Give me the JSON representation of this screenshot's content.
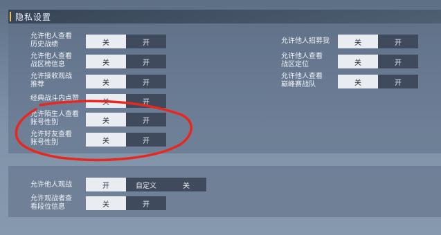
{
  "header": {
    "title": "隐私设置"
  },
  "top_left": [
    {
      "label": "允许他人查看历史战绩",
      "line1": "允许他人查看",
      "line2": "历史战绩",
      "options": [
        "关",
        "开"
      ],
      "selected": "关"
    },
    {
      "label": "允许他人查看战区榜信息",
      "line1": "允许他人查看",
      "line2": "战区榜信息",
      "options": [
        "关",
        "开"
      ],
      "selected": "关"
    },
    {
      "label": "允许接收观战推荐",
      "line1": "允许接收观战",
      "line2": "推荐",
      "options": [
        "关",
        "开"
      ],
      "selected": "关"
    },
    {
      "label": "经典战斗内点赞",
      "line1": "经典战斗内点赞",
      "line2": "",
      "options": [
        "关",
        "开"
      ],
      "selected": "关"
    },
    {
      "label": "允许陌生人查看账号性别",
      "line1": "允许陌生人查看",
      "line2": "账号性别",
      "options": [
        "关",
        "开"
      ],
      "selected": "关"
    },
    {
      "label": "允许好友查看账号性别",
      "line1": "允许好友查看",
      "line2": "账号性别",
      "options": [
        "关",
        "开"
      ],
      "selected": "关"
    }
  ],
  "top_right": [
    {
      "label": "允许他人招募我",
      "line1": "允许他人招募我",
      "line2": "",
      "options": [
        "关",
        "开"
      ],
      "selected": "关"
    },
    {
      "label": "允许他人查看战区定位",
      "line1": "允许他人查看",
      "line2": "战区定位",
      "options": [
        "关",
        "开"
      ],
      "selected": "关"
    },
    {
      "label": "允许他人查看巅峰赛战队",
      "line1": "允许他人查看",
      "line2": "巅峰赛战队",
      "options": [
        "关",
        "开"
      ],
      "selected": "关"
    }
  ],
  "bottom": [
    {
      "label": "允许他人观战",
      "line1": "允许他人观战",
      "line2": "",
      "options": [
        "开",
        "自定义",
        "关"
      ],
      "selected": "开"
    },
    {
      "label": "允许观战者查看段位信息",
      "line1": "允许观战者查",
      "line2": "看段位信息",
      "options": [
        "关",
        "开"
      ],
      "selected": "关"
    }
  ],
  "colors": {
    "highlight_segment": "#e9edf1",
    "dark_segment": "#3f4b5c",
    "title_accent": "#f0c14a",
    "annotation_ink": "#e8281e"
  }
}
